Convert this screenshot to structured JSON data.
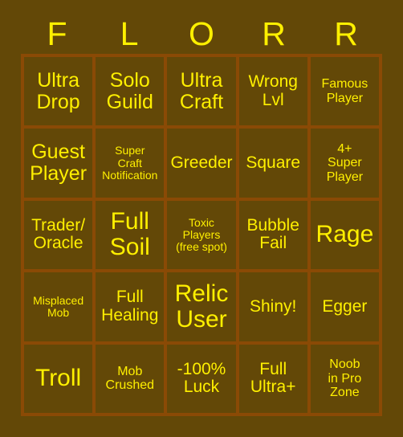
{
  "card": {
    "title_letters": [
      "F",
      "L",
      "O",
      "R",
      "R"
    ],
    "colors": {
      "background": "#634807",
      "grid_border": "#8A4A05",
      "cell_fill": "#634807",
      "text": "#FFF000"
    },
    "rows": [
      [
        {
          "text": "Ultra\nDrop",
          "size": "lg"
        },
        {
          "text": "Solo\nGuild",
          "size": "lg"
        },
        {
          "text": "Ultra\nCraft",
          "size": "lg"
        },
        {
          "text": "Wrong\nLvl",
          "size": "md"
        },
        {
          "text": "Famous\nPlayer",
          "size": "sm"
        }
      ],
      [
        {
          "text": "Guest\nPlayer",
          "size": "lg"
        },
        {
          "text": "Super\nCraft\nNotification",
          "size": "xs"
        },
        {
          "text": "Greeder",
          "size": "md"
        },
        {
          "text": "Square",
          "size": "md"
        },
        {
          "text": "4+\nSuper\nPlayer",
          "size": "sm"
        }
      ],
      [
        {
          "text": "Trader/\nOracle",
          "size": "md"
        },
        {
          "text": "Full\nSoil",
          "size": "xl"
        },
        {
          "text": "Toxic\nPlayers\n(free spot)",
          "size": "xs"
        },
        {
          "text": "Bubble\nFail",
          "size": "md"
        },
        {
          "text": "Rage",
          "size": "xl"
        }
      ],
      [
        {
          "text": "Misplaced\nMob",
          "size": "xs"
        },
        {
          "text": "Full\nHealing",
          "size": "md"
        },
        {
          "text": "Relic\nUser",
          "size": "xl"
        },
        {
          "text": "Shiny!",
          "size": "md"
        },
        {
          "text": "Egger",
          "size": "md"
        }
      ],
      [
        {
          "text": "Troll",
          "size": "xl"
        },
        {
          "text": "Mob\nCrushed",
          "size": "sm"
        },
        {
          "text": "-100%\nLuck",
          "size": "md"
        },
        {
          "text": "Full\nUltra+",
          "size": "md"
        },
        {
          "text": "Noob\nin Pro\nZone",
          "size": "sm"
        }
      ]
    ]
  }
}
